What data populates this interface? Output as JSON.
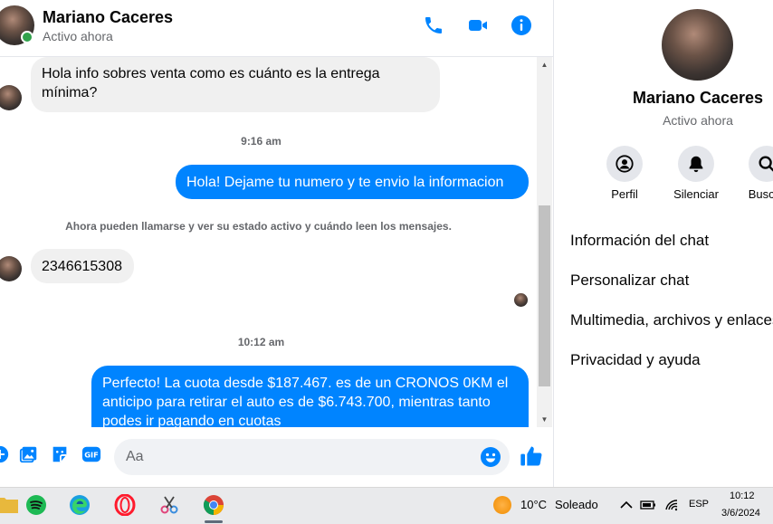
{
  "chat": {
    "contact_name": "Mariano Caceres",
    "status": "Activo ahora"
  },
  "messages": [
    {
      "from": "in",
      "text": "Hola info sobres venta como es cuánto es la entrega mínima?"
    },
    {
      "from": "time",
      "text": "9:16 am"
    },
    {
      "from": "out",
      "text": "Hola! Dejame tu numero y te envio la informacion"
    },
    {
      "from": "system",
      "text": "Ahora pueden llamarse y ver su estado activo y cuándo leen los mensajes."
    },
    {
      "from": "in",
      "text": "2346615308"
    },
    {
      "from": "time",
      "text": "10:12 am"
    },
    {
      "from": "out",
      "text": "Perfecto! La cuota desde $187.467. es de un CRONOS 0KM el anticipo para retirar el auto es de $6.743.700, mientras tanto podes ir pagando en cuotas"
    }
  ],
  "composer": {
    "placeholder": "Aa"
  },
  "right_panel": {
    "name": "Mariano Caceres",
    "status": "Activo ahora",
    "actions": [
      {
        "label": "Perfil",
        "icon": "profile-icon"
      },
      {
        "label": "Silenciar",
        "icon": "bell-icon"
      },
      {
        "label": "Buscar",
        "icon": "search-icon"
      }
    ],
    "items": [
      "Información del chat",
      "Personalizar chat",
      "Multimedia, archivos y enlaces",
      "Privacidad y ayuda"
    ]
  },
  "taskbar": {
    "weather_temp": "10°C",
    "weather_desc": "Soleado",
    "language": "ESP",
    "time": "10:12",
    "date": "3/6/2024"
  },
  "colors": {
    "accent": "#0084ff",
    "incoming_bubble": "#f0f0f0",
    "online": "#31a24c"
  }
}
